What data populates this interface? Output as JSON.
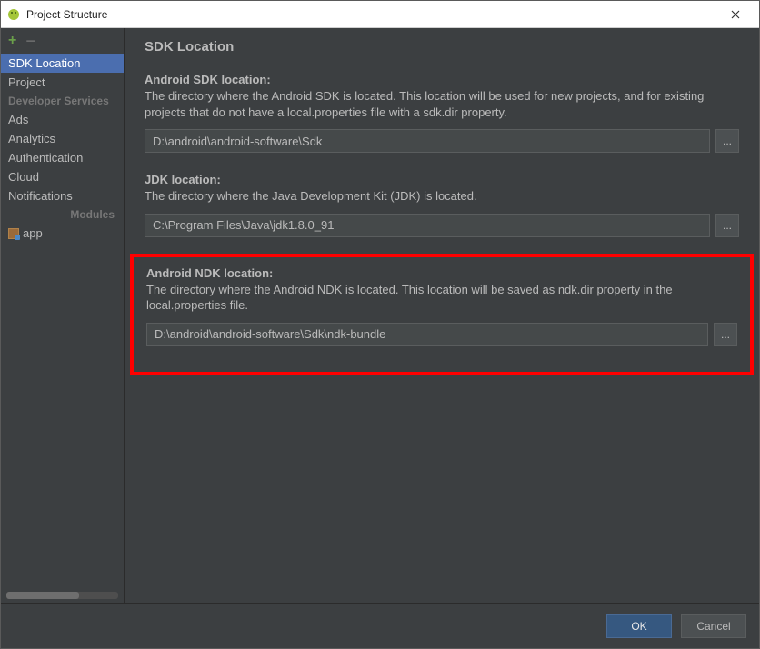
{
  "window": {
    "title": "Project Structure"
  },
  "sidebar": {
    "items": [
      {
        "label": "SDK Location",
        "selected": true
      },
      {
        "label": "Project",
        "selected": false
      }
    ],
    "dev_header": "Developer Services",
    "dev_items": [
      {
        "label": "Ads"
      },
      {
        "label": "Analytics"
      },
      {
        "label": "Authentication"
      },
      {
        "label": "Cloud"
      },
      {
        "label": "Notifications"
      }
    ],
    "modules_header": "Modules",
    "modules": [
      {
        "label": "app"
      }
    ]
  },
  "content": {
    "title": "SDK Location",
    "sdk": {
      "label": "Android SDK location:",
      "desc": "The directory where the Android SDK is located. This location will be used for new projects, and for existing projects that do not have a local.properties file with a sdk.dir property.",
      "value": "D:\\android\\android-software\\Sdk",
      "browse": "..."
    },
    "jdk": {
      "label": "JDK location:",
      "desc": "The directory where the Java Development Kit (JDK) is located.",
      "value": "C:\\Program Files\\Java\\jdk1.8.0_91",
      "browse": "..."
    },
    "ndk": {
      "label": "Android NDK location:",
      "desc": "The directory where the Android NDK is located. This location will be saved as ndk.dir property in the local.properties file.",
      "value": "D:\\android\\android-software\\Sdk\\ndk-bundle",
      "browse": "..."
    }
  },
  "footer": {
    "ok": "OK",
    "cancel": "Cancel"
  }
}
